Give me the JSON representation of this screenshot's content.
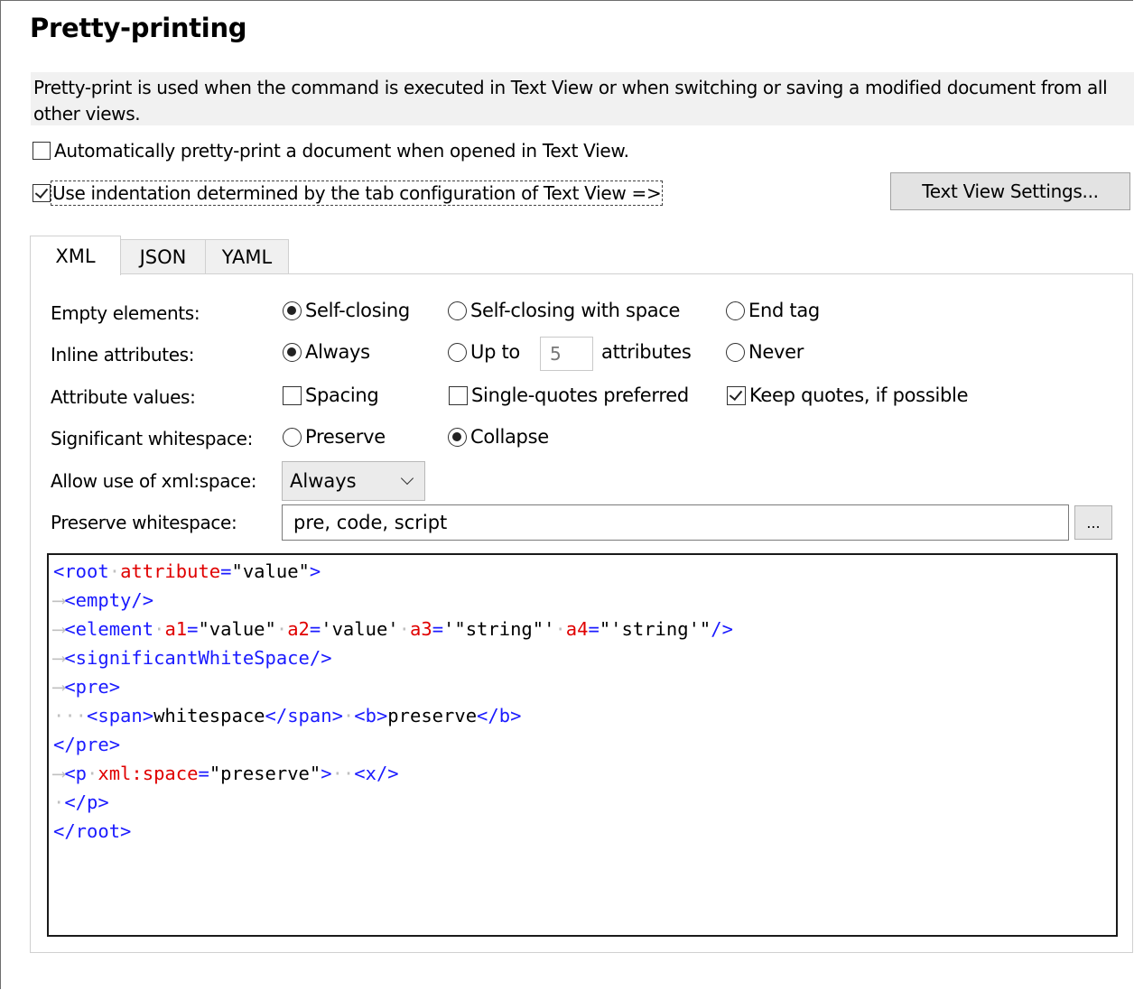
{
  "title": "Pretty-printing",
  "description": "Pretty-print is used when the command is executed in Text View or when switching or saving a modified document from all other views.",
  "auto_pretty_print": {
    "label": "Automatically pretty-print a document when opened in Text View.",
    "checked": false
  },
  "use_indentation": {
    "label": "Use indentation determined by the tab configuration of Text View =>",
    "checked": true
  },
  "text_view_settings_button": "Text View Settings...",
  "tabs": [
    {
      "label": "XML",
      "active": true
    },
    {
      "label": "JSON",
      "active": false
    },
    {
      "label": "YAML",
      "active": false
    }
  ],
  "empty_elements": {
    "label": "Empty elements:",
    "options": [
      "Self-closing",
      "Self-closing with space",
      "End tag"
    ],
    "selected": "Self-closing"
  },
  "inline_attributes": {
    "label": "Inline attributes:",
    "always": "Always",
    "up_to": "Up to",
    "count": "5",
    "attributes": "attributes",
    "never": "Never",
    "selected": "Always"
  },
  "attribute_values": {
    "label": "Attribute values:",
    "spacing": {
      "label": "Spacing",
      "checked": false
    },
    "single_quotes": {
      "label": "Single-quotes preferred",
      "checked": false
    },
    "keep_quotes": {
      "label": "Keep quotes, if possible",
      "checked": true
    }
  },
  "significant_whitespace": {
    "label": "Significant whitespace:",
    "options": [
      "Preserve",
      "Collapse"
    ],
    "selected": "Collapse"
  },
  "xml_space": {
    "label": "Allow use of xml:space:",
    "value": "Always"
  },
  "preserve_whitespace": {
    "label": "Preserve whitespace:",
    "value": "pre, code, script",
    "browse_label": "..."
  },
  "preview": {
    "lines": [
      "<root attribute=\"value\">",
      "<empty/>",
      "<element a1=\"value\" a2='value' a3='\"string\"' a4=\"'string'\"/>",
      "<significantWhiteSpace/>",
      "<pre>",
      "<span>whitespace</span> <b>preserve</b>",
      "</pre>",
      "<p xml:space=\"preserve\">  <x/>",
      "</p>",
      "</root>"
    ]
  }
}
